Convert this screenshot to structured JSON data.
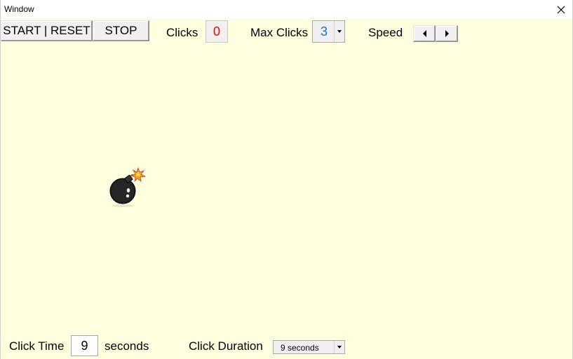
{
  "window": {
    "title": "Window"
  },
  "toolbar": {
    "start_reset_label": "START | RESET",
    "stop_label": "STOP",
    "clicks_label": "Clicks",
    "clicks_value": "0",
    "max_clicks_label": "Max Clicks",
    "max_clicks_value": "3",
    "speed_label": "Speed"
  },
  "footer": {
    "click_time_label": "Click Time",
    "click_time_value": "9",
    "seconds_label": "seconds",
    "click_duration_label": "Click Duration",
    "click_duration_value": "9 seconds"
  },
  "colors": {
    "canvas_bg": "#ffffe0",
    "clicks_value": "#ff0000",
    "max_clicks_value": "#1e6fd9"
  },
  "icons": {
    "close": "close-icon",
    "bomb": "bomb-icon",
    "speed_decrease": "left-arrow-icon",
    "speed_increase": "right-arrow-icon",
    "dropdown": "chevron-down-icon"
  }
}
